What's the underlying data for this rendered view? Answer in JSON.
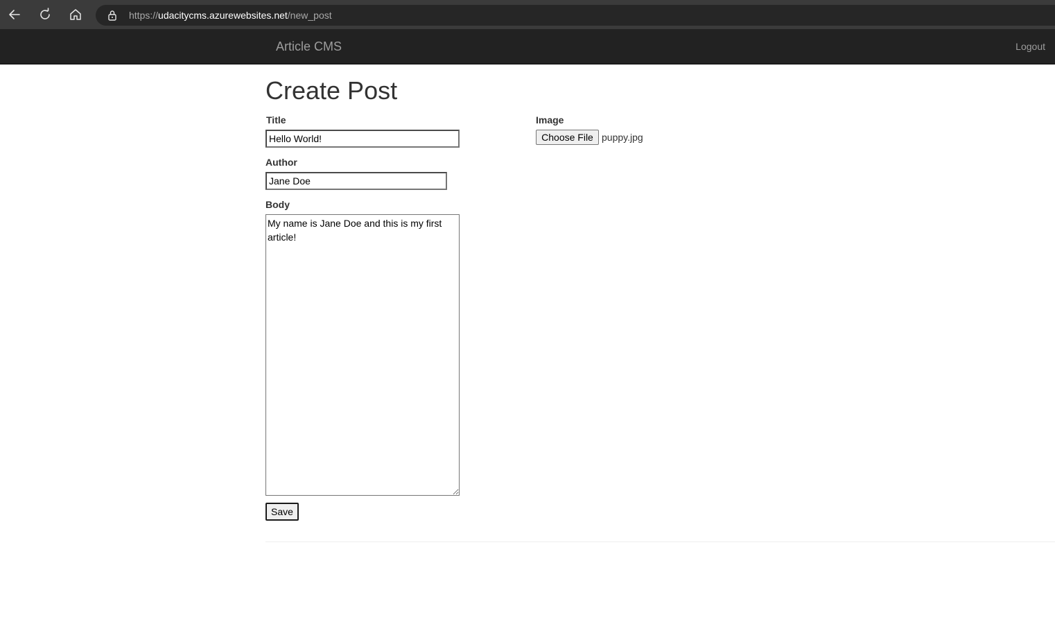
{
  "browser": {
    "url_scheme": "https://",
    "url_host": "udacitycms.azurewebsites.net",
    "url_path": "/new_post"
  },
  "navbar": {
    "brand": "Article CMS",
    "logout_label": "Logout"
  },
  "page": {
    "title": "Create Post"
  },
  "form": {
    "title_label": "Title",
    "title_value": "Hello World!",
    "author_label": "Author",
    "author_value": "Jane Doe",
    "body_label": "Body",
    "body_value": "My name is Jane Doe and this is my first article!",
    "image_label": "Image",
    "choose_file_label": "Choose File",
    "file_name": "puppy.jpg",
    "save_label": "Save"
  },
  "icons": {
    "back": "back-arrow-icon",
    "reload": "reload-icon",
    "home": "home-icon",
    "lock": "lock-icon"
  },
  "colors": {
    "browser_bar": "#3b3b3b",
    "address_bar": "#262626",
    "navbar": "#222222",
    "navbar_text": "#9d9d9d"
  }
}
